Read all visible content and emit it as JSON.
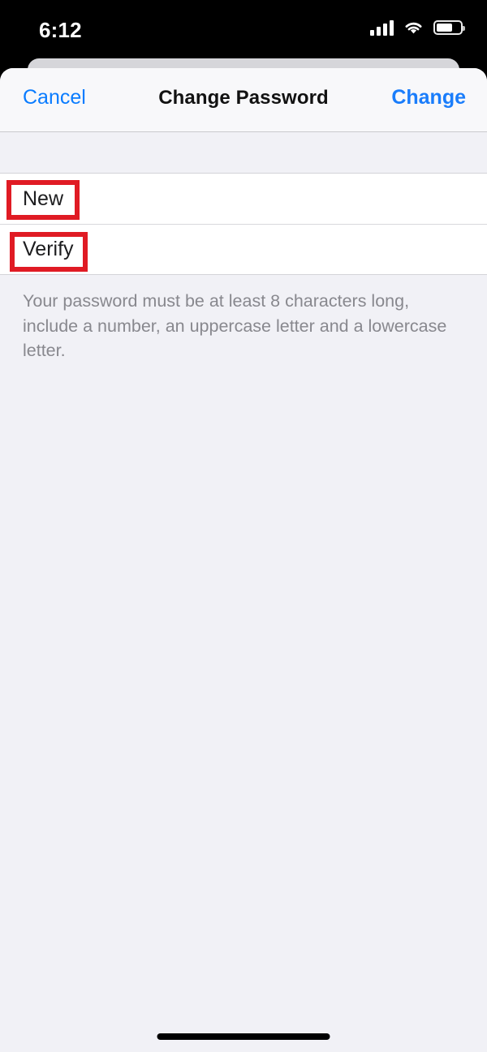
{
  "status_bar": {
    "time": "6:12",
    "cellular_icon": "cellular-signal-icon",
    "wifi_icon": "wifi-icon",
    "battery_icon": "battery-icon",
    "battery_level_percent": 58
  },
  "nav": {
    "cancel_label": "Cancel",
    "title": "Change Password",
    "change_label": "Change"
  },
  "form": {
    "fields": [
      {
        "label": "New",
        "value": "",
        "placeholder": ""
      },
      {
        "label": "Verify",
        "value": "",
        "placeholder": ""
      }
    ],
    "footer_note": "Your password must be at least 8 characters long, include a number, an uppercase letter and a lowercase letter."
  },
  "annotations": {
    "highlight_color": "#e01b24",
    "boxes": [
      {
        "target": "New"
      },
      {
        "target": "Verify"
      }
    ]
  },
  "colors": {
    "accent_blue": "#0a7cff",
    "sheet_background": "#f1f1f6",
    "row_background": "#ffffff",
    "footer_text": "#88888e"
  }
}
